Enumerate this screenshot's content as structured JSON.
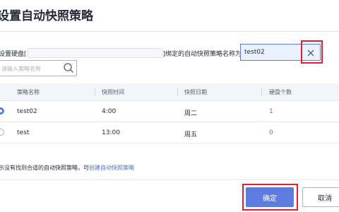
{
  "dialog": {
    "title": "设置自动快照策略"
  },
  "instruction": {
    "prefix": "设置硬盘[",
    "suffix": "]绑定的自动快照策略名称为:"
  },
  "policy_input": {
    "value": "test02"
  },
  "search": {
    "placeholder": "请输入策略名称"
  },
  "table": {
    "columns": [
      "策略名称",
      "快照时间",
      "快照日期",
      "硬盘个数"
    ],
    "rows": [
      {
        "selected": true,
        "name": "test02",
        "time": "4:00",
        "day": "周二",
        "disks": "1"
      },
      {
        "selected": false,
        "name": "test",
        "time": "13:00",
        "day": "周五",
        "disks": "0"
      }
    ]
  },
  "hint": {
    "text": "示没有找到合适的自动快照策略，可",
    "link": "创建自动快照策略"
  },
  "footer": {
    "confirm_label": "确定",
    "cancel_label": "取消"
  },
  "colors": {
    "primary": "#5e7ce0",
    "link": "#526ecc",
    "highlight": "#e0202e"
  }
}
